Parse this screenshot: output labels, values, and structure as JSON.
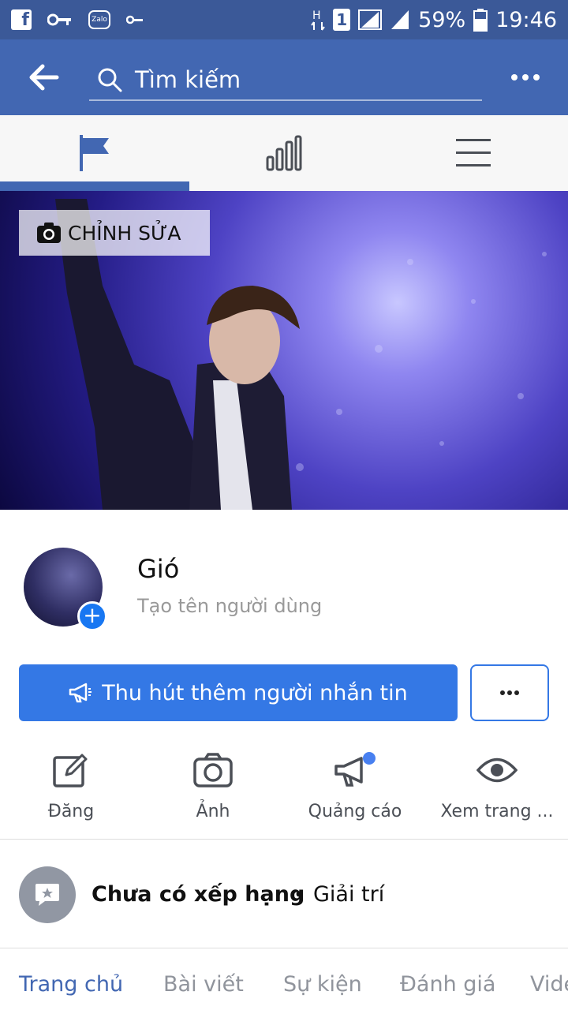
{
  "status_bar": {
    "battery": "59%",
    "time": "19:46",
    "sim_label": "1",
    "zalo_label": "Zalo",
    "network_label": "H",
    "left_icons": [
      "facebook-icon",
      "key-icon",
      "zalo-icon",
      "key-small-icon"
    ],
    "right_icons": [
      "network-h-icon",
      "sim1-icon",
      "signal-icon",
      "signal-icon-2",
      "battery-icon"
    ]
  },
  "app_bar": {
    "search_placeholder": "Tìm kiếm",
    "icons": [
      "back-arrow-icon",
      "search-icon",
      "more-icon"
    ]
  },
  "tabs": [
    {
      "name": "page",
      "icon": "flag-icon",
      "active": true
    },
    {
      "name": "insights",
      "icon": "bar-chart-icon",
      "active": false
    },
    {
      "name": "menu",
      "icon": "hamburger-icon",
      "active": false
    }
  ],
  "cover": {
    "edit_label": "CHỈNH SỬA",
    "edit_icon": "camera-icon"
  },
  "profile": {
    "name": "Gió",
    "username_prompt": "Tạo tên người dùng"
  },
  "cta": {
    "label": "Thu hút thêm người nhắn tin",
    "icon": "megaphone-icon",
    "more_icon": "more-icon"
  },
  "actions": [
    {
      "label": "Đăng",
      "icon": "edit-icon"
    },
    {
      "label": "Ảnh",
      "icon": "camera-icon"
    },
    {
      "label": "Quảng cáo",
      "icon": "megaphone-icon",
      "badge": true
    },
    {
      "label": "Xem trang ...",
      "icon": "eye-icon"
    }
  ],
  "rating": {
    "text": "Chưa có xếp hạng",
    "category": "Giải trí",
    "icon": "star-bubble-icon"
  },
  "bottom_tabs": [
    "Trang chủ",
    "Bài viết",
    "Sự kiện",
    "Đánh giá",
    "Video"
  ],
  "colors": {
    "status_bar": "#3b5998",
    "app_bar": "#4267b2",
    "cta": "#3478e5",
    "active_tab": "#4267b2"
  }
}
